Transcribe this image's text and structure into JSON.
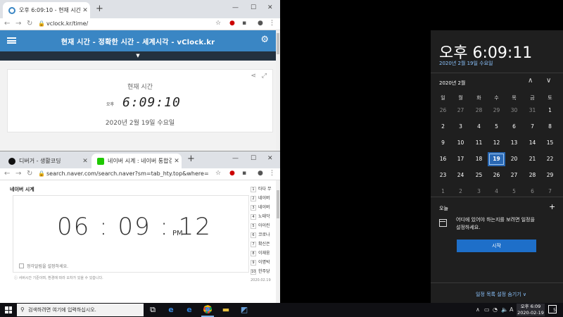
{
  "browser_top": {
    "tab_title": "오후 6:09:10 - 현재 시간",
    "url": "vclock.kr/time/",
    "site_title": "현재 시간 - 정확한 시간 - 세계시각 - vClock.kr",
    "card_caption": "현재 시간",
    "ampm": "오후",
    "time": "6:09:10",
    "date": "2020년 2월 19일 수요일"
  },
  "browser_bottom": {
    "tabs": [
      "디버거 - 생활코딩",
      "네이버 시계 : 네이버 통합검색"
    ],
    "url": "search.naver.com/search.naver?sm=tab_hty.top&where=nexearch...",
    "section_title": "네이버 시계",
    "big_time": "06 : 09 : 12",
    "big_pm": "PM",
    "alarm_label": "정각알림을 설정하세요.",
    "footnote": "ⓘ 서버시간 기준이며, 환경에 따라 오차가 있을 수 있습니다.",
    "ranking": [
      "타다 무",
      "네이버",
      "네이버",
      "노태악",
      "아이린",
      "코로나",
      "확신은",
      "이재웅",
      "이명박",
      "한주당"
    ],
    "ranking_date": "2020.02.19"
  },
  "calendar_panel": {
    "clock": "오후 6:09:11",
    "date": "2020년 2월 19일 수요일",
    "month": "2020년 2월",
    "weekdays": [
      "일",
      "월",
      "화",
      "수",
      "목",
      "금",
      "토"
    ],
    "days": [
      [
        "26",
        "27",
        "28",
        "29",
        "30",
        "31",
        "1"
      ],
      [
        "2",
        "3",
        "4",
        "5",
        "6",
        "7",
        "8"
      ],
      [
        "9",
        "10",
        "11",
        "12",
        "13",
        "14",
        "15"
      ],
      [
        "16",
        "17",
        "18",
        "19",
        "20",
        "21",
        "22"
      ],
      [
        "23",
        "24",
        "25",
        "26",
        "27",
        "28",
        "29"
      ],
      [
        "1",
        "2",
        "3",
        "4",
        "5",
        "6",
        "7"
      ]
    ],
    "dim_cells": [
      [
        0,
        0
      ],
      [
        0,
        1
      ],
      [
        0,
        2
      ],
      [
        0,
        3
      ],
      [
        0,
        4
      ],
      [
        0,
        5
      ],
      [
        5,
        0
      ],
      [
        5,
        1
      ],
      [
        5,
        2
      ],
      [
        5,
        3
      ],
      [
        5,
        4
      ],
      [
        5,
        5
      ],
      [
        5,
        6
      ]
    ],
    "today_cell": [
      3,
      3
    ],
    "today_label": "오늘",
    "event_message": "어디에 있어야 하는지를 보려면 일정을 설정하세요.",
    "start_button": "시작",
    "hide_agenda": "일정 목록 설정 숨기기 ∨"
  },
  "taskbar": {
    "search_placeholder": "검색하려면 여기에 입력하십시오.",
    "clock_time": "오후 6:09",
    "clock_date": "2020-02-19",
    "ime": "A",
    "notif_count": "5"
  },
  "colors": {
    "vclock_blue": "#3a86c4",
    "panel_bg": "#1f1f1f",
    "accent": "#2a68b3"
  }
}
